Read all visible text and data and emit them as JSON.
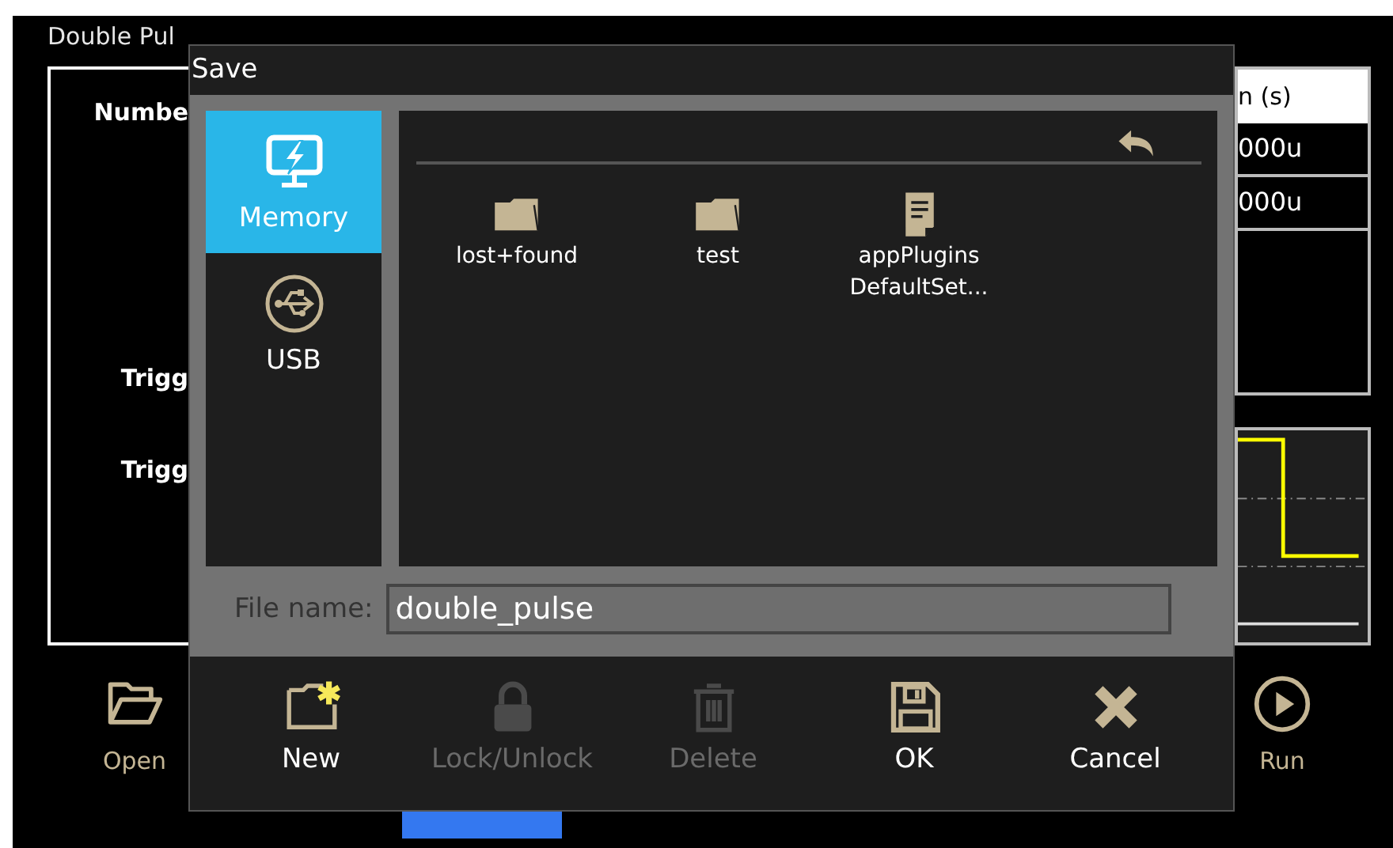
{
  "app": {
    "title": "Double Pul",
    "labels": [
      "Numbe",
      "Trigg",
      "Trigg"
    ],
    "table": {
      "header": "n (s)",
      "rows": [
        "000u",
        "000u"
      ]
    },
    "toolbar": [
      {
        "label": "Open",
        "kind": "open"
      },
      {
        "label": "Run",
        "kind": "run"
      }
    ]
  },
  "dialog": {
    "title": "Save",
    "locations": [
      {
        "label": "Memory",
        "kind": "memory",
        "selected": true
      },
      {
        "label": "USB",
        "kind": "usb",
        "selected": false
      }
    ],
    "files": [
      {
        "name": "lost+found",
        "kind": "folder"
      },
      {
        "name": "test",
        "kind": "folder"
      },
      {
        "name": "appPlugins DefaultSet...",
        "kind": "file"
      }
    ],
    "file_name": {
      "label": "File name:",
      "value": "double_pulse"
    },
    "buttons": [
      {
        "label": "New",
        "kind": "new",
        "disabled": false
      },
      {
        "label": "Lock/Unlock",
        "kind": "lock",
        "disabled": true
      },
      {
        "label": "Delete",
        "kind": "delete",
        "disabled": true
      },
      {
        "label": "OK",
        "kind": "ok",
        "disabled": false
      },
      {
        "label": "Cancel",
        "kind": "cancel",
        "disabled": false
      }
    ]
  }
}
